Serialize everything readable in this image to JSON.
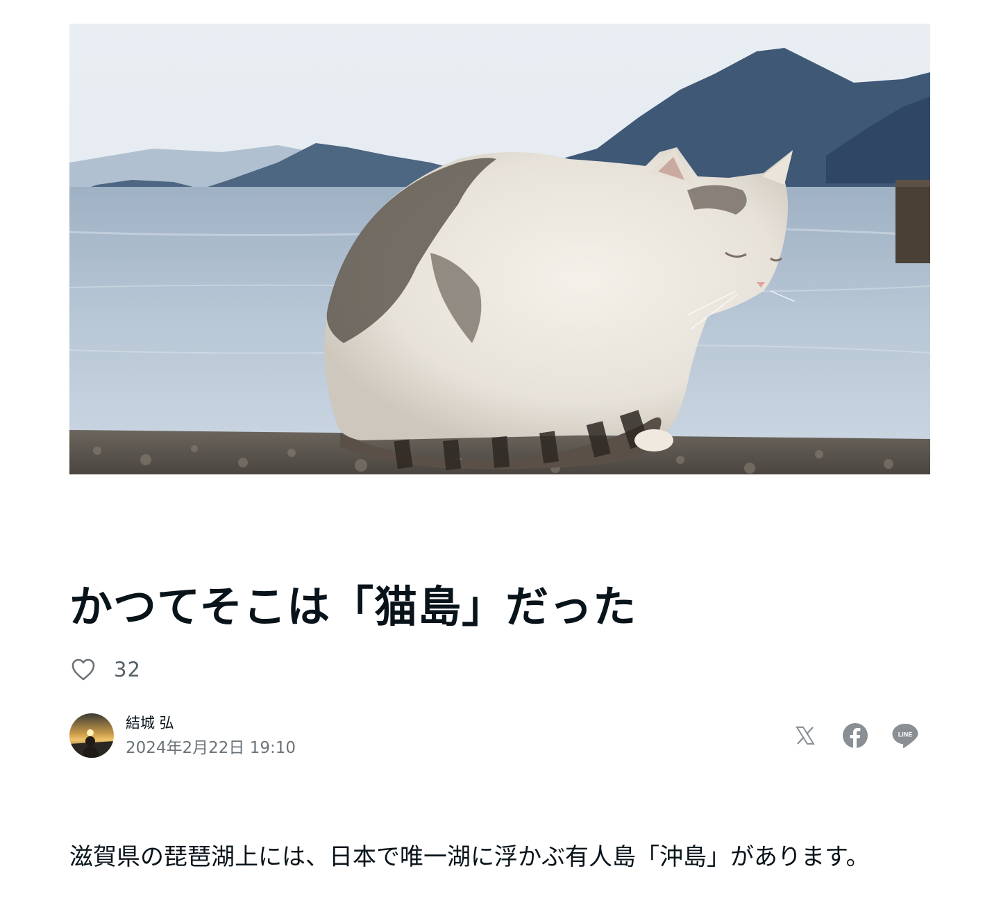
{
  "article": {
    "title": "かつてそこは「猫島」だった",
    "likes": "32",
    "author": "結城 弘",
    "published": "2024年2月22日 19:10",
    "lead": "滋賀県の琵琶湖上には、日本で唯一湖に浮かぶ有人島「沖島」があります。"
  },
  "share": {
    "items": [
      "x-share",
      "facebook-share",
      "line-share"
    ],
    "line_label": "LINE"
  },
  "icons": {
    "like": "heart-icon",
    "x": "x-logo-icon",
    "facebook": "facebook-icon",
    "line": "line-icon"
  },
  "colors": {
    "text": "#08131a",
    "muted": "#6b7378",
    "icon": "#8a8f93"
  }
}
